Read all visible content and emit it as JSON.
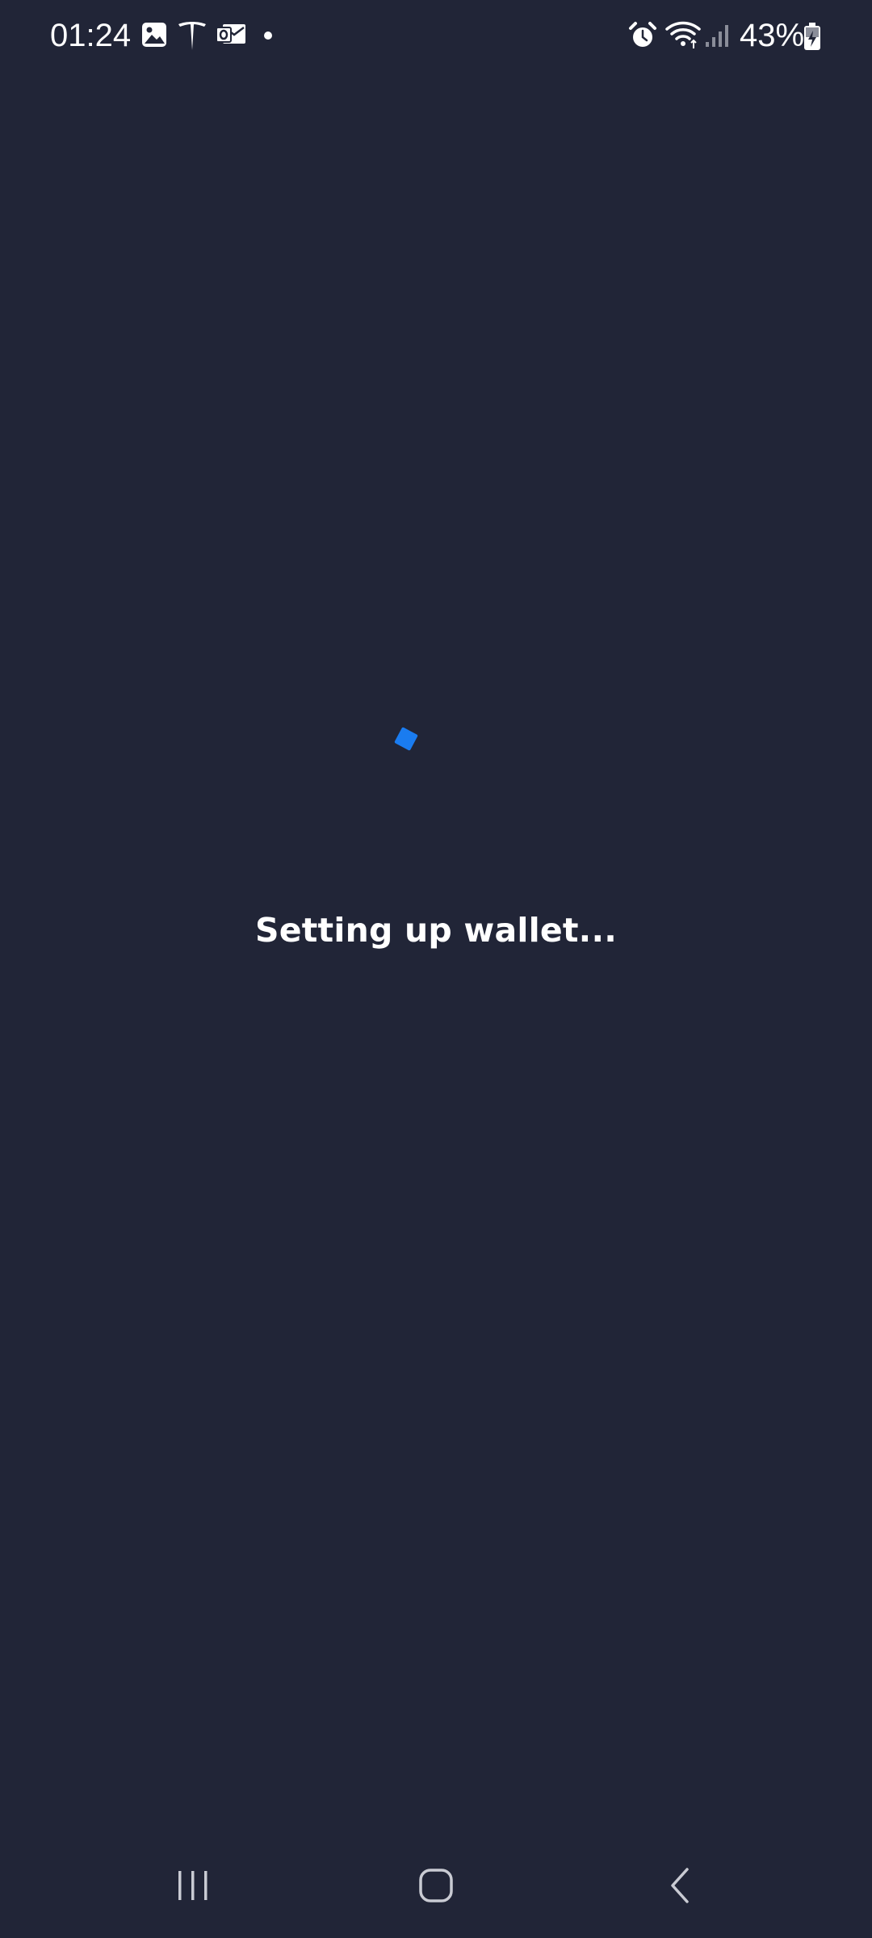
{
  "status_bar": {
    "time": "01:24",
    "battery_percent": "43%",
    "notification_icons": [
      "gallery-icon",
      "tesla-icon",
      "outlook-icon",
      "dot-icon"
    ],
    "system_icons": [
      "alarm-icon",
      "wifi-icon",
      "signal-icon",
      "battery-charging-icon"
    ]
  },
  "main": {
    "loading_text": "Setting up wallet..."
  },
  "colors": {
    "background": "#212537",
    "accent": "#1a7cf0",
    "text": "#ffffff"
  },
  "nav_bar": {
    "buttons": [
      "recent-apps",
      "home",
      "back"
    ]
  }
}
